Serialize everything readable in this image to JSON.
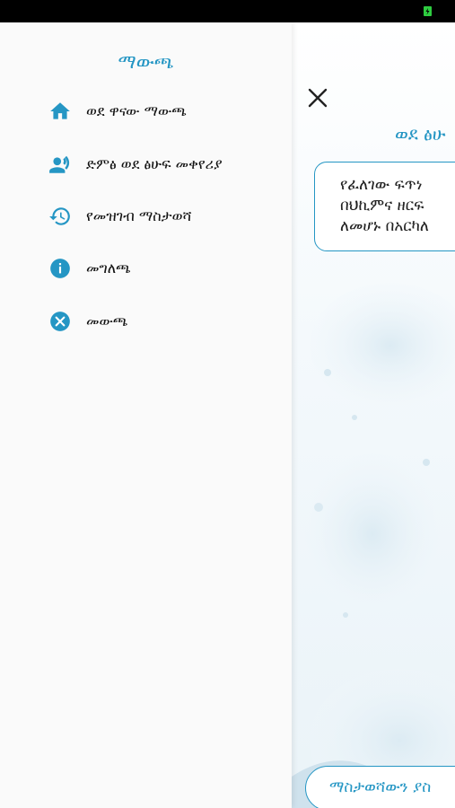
{
  "colors": {
    "accent": "#2596c4",
    "status_icon": "#2ecc40",
    "statusbar": "#000000"
  },
  "drawer": {
    "title": "ማውጫ",
    "items": [
      {
        "label": "ወደ ዋናው ማውጫ",
        "icon": "home-icon"
      },
      {
        "label": "ድምፅ ወደ ፅሁፍ መቀየሪያ",
        "icon": "voice-user-icon"
      },
      {
        "label": "የመዝገብ ማስታወሻ",
        "icon": "history-icon"
      },
      {
        "label": "መግለጫ",
        "icon": "info-icon"
      },
      {
        "label": "መውጫ",
        "icon": "close-circle-icon"
      }
    ]
  },
  "main": {
    "heading": "ወደ ፅሁ",
    "info_lines": [
      "የፈለገው ፍጥነ",
      "በህኪምና ዘርፍ",
      "ለመሆኑ በአርካለ"
    ],
    "bottom_button": "ማስታወሻውን ያስ",
    "close_icon": "close-icon"
  }
}
